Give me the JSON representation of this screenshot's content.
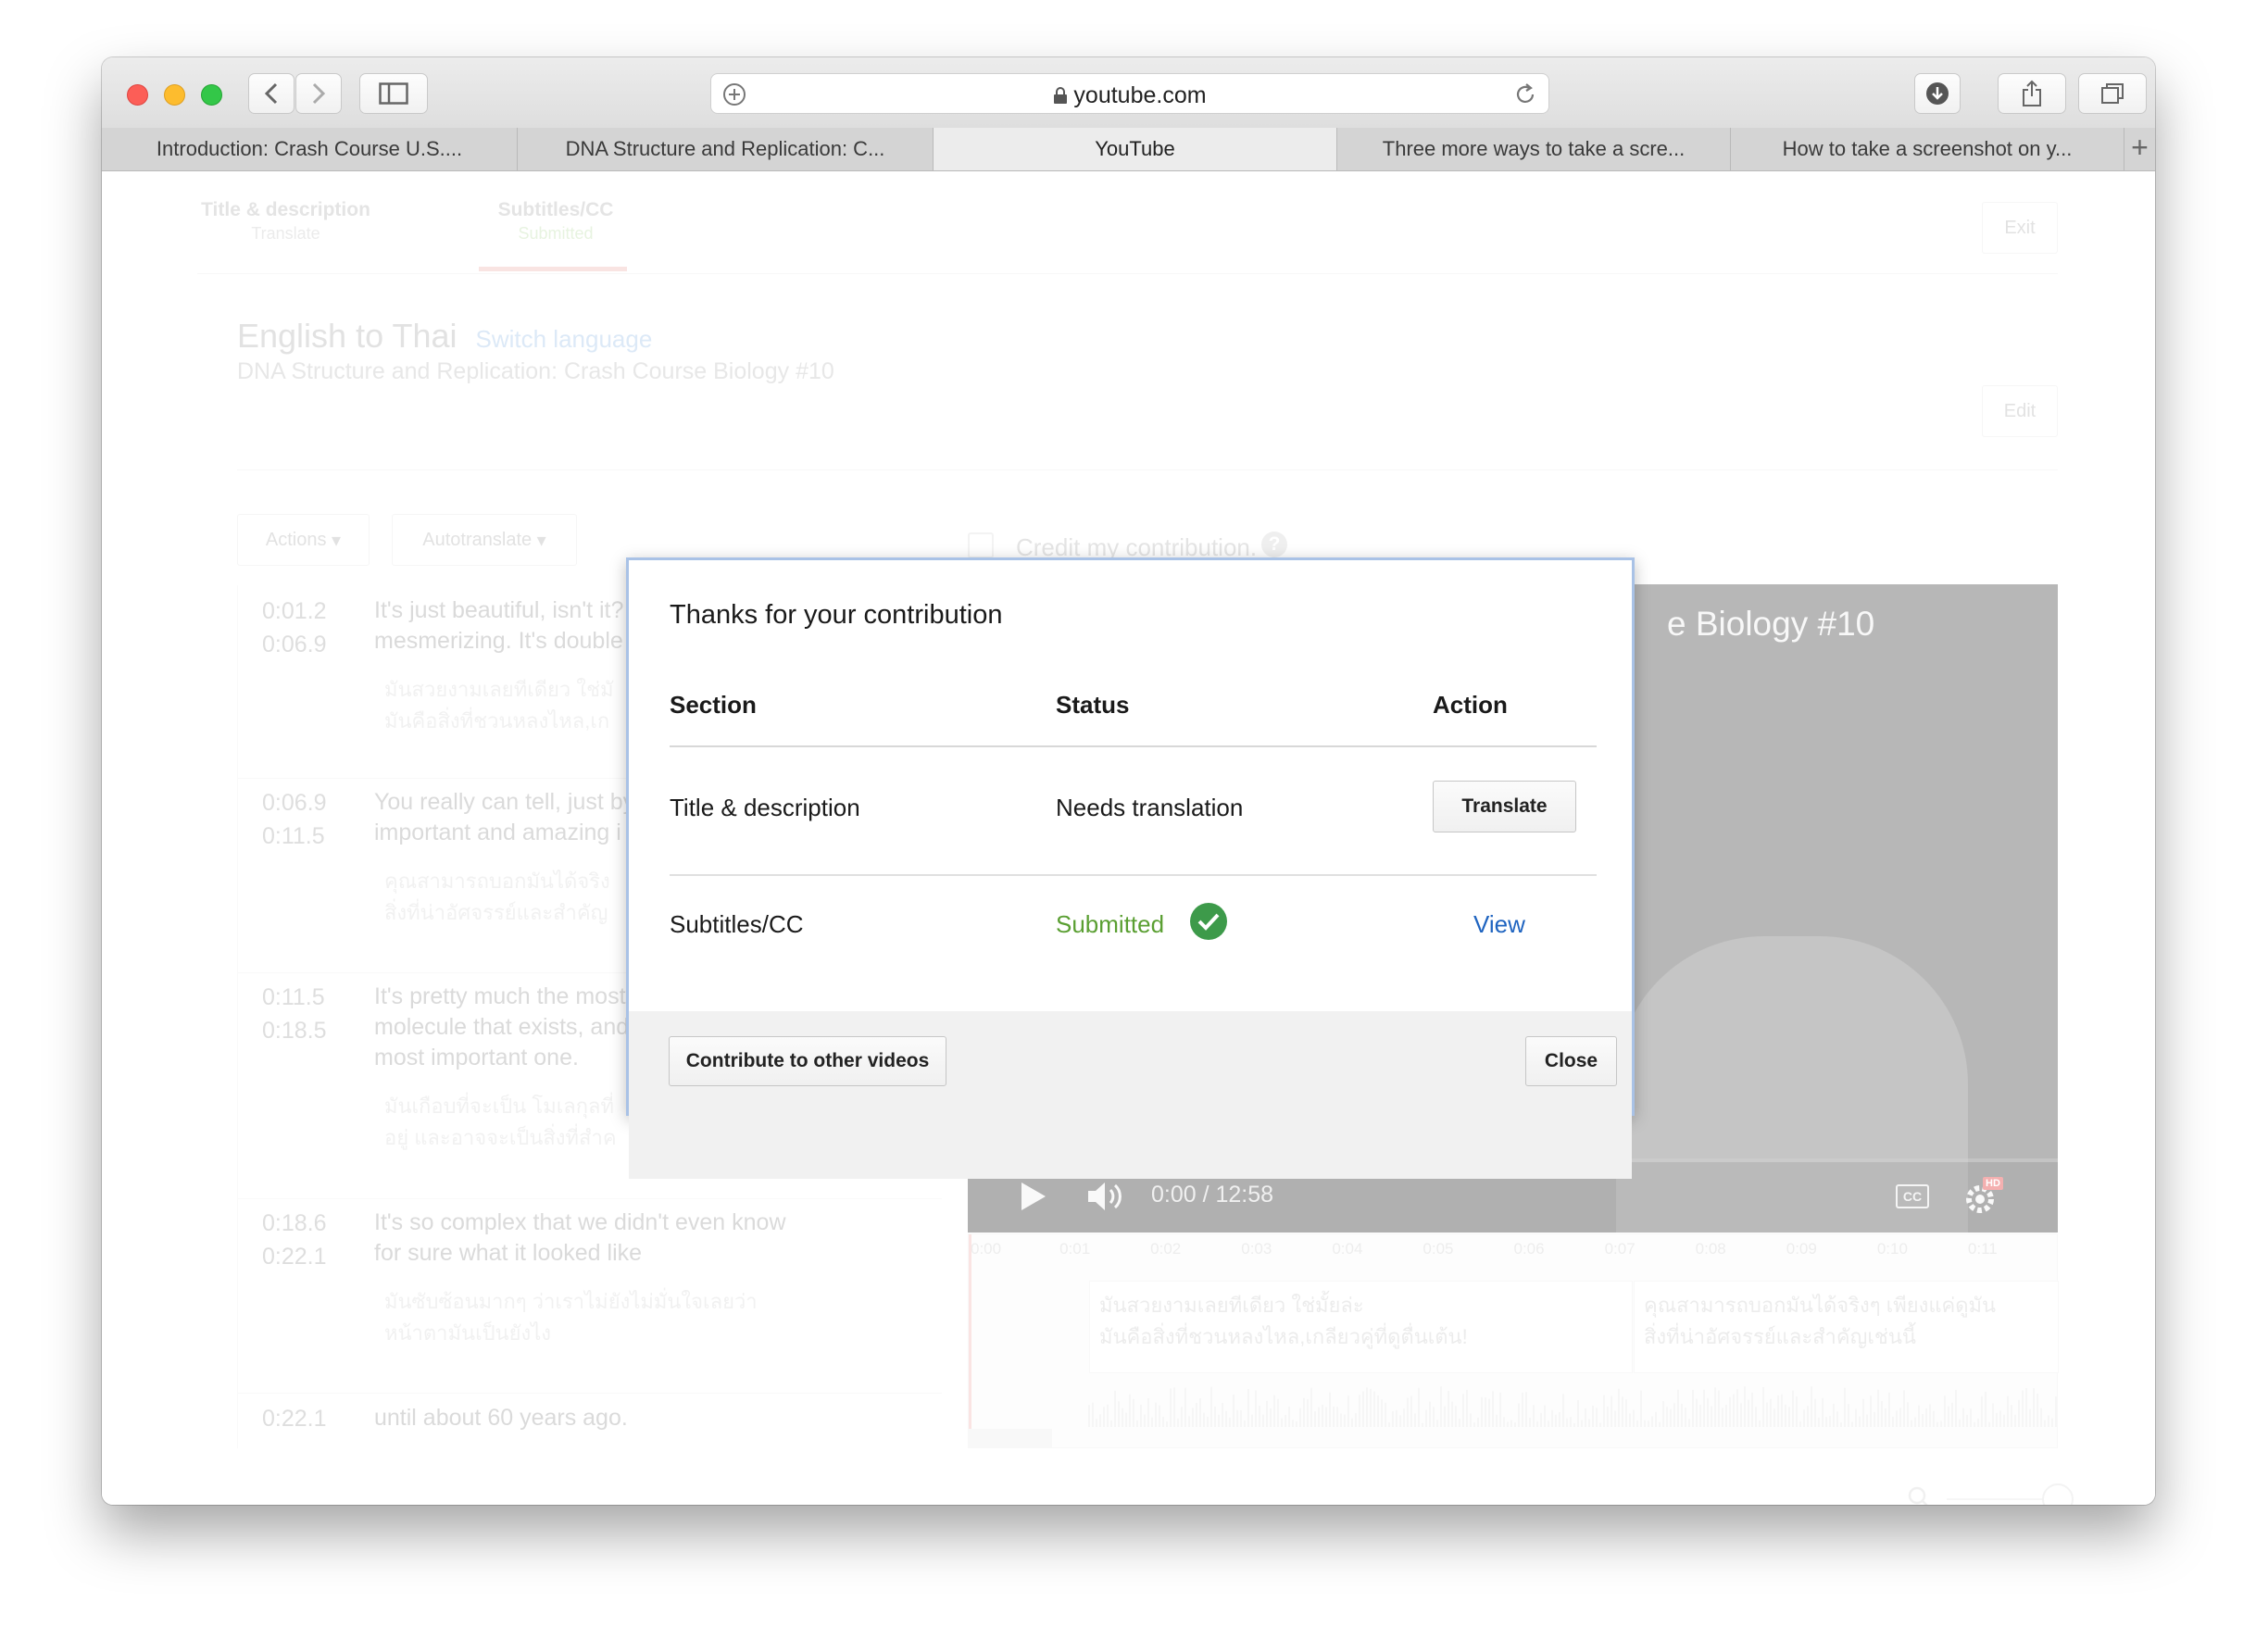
{
  "browser": {
    "url": "youtube.com",
    "tabs": [
      {
        "label": "Introduction: Crash Course U.S...."
      },
      {
        "label": "DNA Structure and Replication: C..."
      },
      {
        "label": "YouTube"
      },
      {
        "label": "Three more ways to take a scre..."
      },
      {
        "label": "How to take a screenshot on y..."
      }
    ]
  },
  "editor": {
    "tabs": [
      {
        "title": "Title & description",
        "sub": "Translate"
      },
      {
        "title": "Subtitles/CC",
        "sub": "Submitted"
      }
    ],
    "exit_label": "Exit",
    "edit_label": "Edit",
    "heading": "English to Thai",
    "switch_language": "Switch language",
    "video_title": "DNA Structure and Replication: Crash Course Biology #10",
    "actions_label": "Actions",
    "autotranslate_label": "Autotranslate",
    "credit_label": "Credit my contribution.",
    "subtitles": [
      {
        "start": "0:01.2",
        "end": "0:06.9",
        "line1": "It's just beautiful, isn't it? It's just",
        "line2": "mesmerizing. It's double",
        "line3": "",
        "thai1": "มันสวยงามเลยทีเดียว ใช่มั",
        "thai2": "มันคือสิ่งที่ชวนหลงไหล,เก"
      },
      {
        "start": "0:06.9",
        "end": "0:11.5",
        "line1": "You really can tell, just by",
        "line2": "important and amazing i",
        "line3": "",
        "thai1": "คุณสามารถบอกมันได้จริง",
        "thai2": "สิ่งที่น่าอัศจรรย์และสำคัญ"
      },
      {
        "start": "0:11.5",
        "end": "0:18.5",
        "line1": "It's pretty much the most",
        "line2": "molecule that exists, and",
        "line3": "most important one.",
        "thai1": "มันเกือบที่จะเป็น โมเลกุลที่",
        "thai2": "อยู่ และอาจจะเป็นสิ่งที่สำค"
      },
      {
        "start": "0:18.6",
        "end": "0:22.1",
        "line1": "It's so complex that we didn't even know",
        "line2": "for sure what it looked like",
        "line3": "",
        "thai1": "มันซับซ้อนมากๆ ว่าเราไม่ยังไม่มั่นใจเลยว่า",
        "thai2": "หน้าตามันเป็นยังไง"
      },
      {
        "start": "0:22.1",
        "end": "",
        "line1": "until about 60 years ago.",
        "line2": "",
        "line3": "",
        "thai1": "",
        "thai2": ""
      }
    ],
    "player": {
      "title_visible": "e Biology #10",
      "time": "0:00 / 12:58",
      "cc": "CC",
      "hd": "HD"
    },
    "timeline": {
      "ticks": [
        "0:00",
        "0:01",
        "0:02",
        "0:03",
        "0:04",
        "0:05",
        "0:06",
        "0:07",
        "0:08",
        "0:09",
        "0:10",
        "0:11"
      ],
      "cue1_line1": "มันสวยงามเลยทีเดียว ใช่มั้ยล่ะ",
      "cue1_line2": "มันคือสิ่งที่ชวนหลงไหล,เกลียวคู่ที่ดูตื่นเต้น!",
      "cue2_line1": "คุณสามารถบอกมันได้จริงๆ เพียงแค่ดูมัน",
      "cue2_line2": "สิ่งที่น่าอัศจรรย์และสำคัญเช่นนี้"
    }
  },
  "dialog": {
    "title": "Thanks for your contribution",
    "headers": {
      "section": "Section",
      "status": "Status",
      "action": "Action"
    },
    "rows": [
      {
        "section": "Title & description",
        "status": "Needs translation",
        "action": "Translate"
      },
      {
        "section": "Subtitles/CC",
        "status": "Submitted",
        "action": "View"
      }
    ],
    "contribute_label": "Contribute to other videos",
    "close_label": "Close",
    "colors": {
      "submitted": "#5a9f32",
      "link": "#1f64c0",
      "check": "#3d9a4a"
    }
  }
}
